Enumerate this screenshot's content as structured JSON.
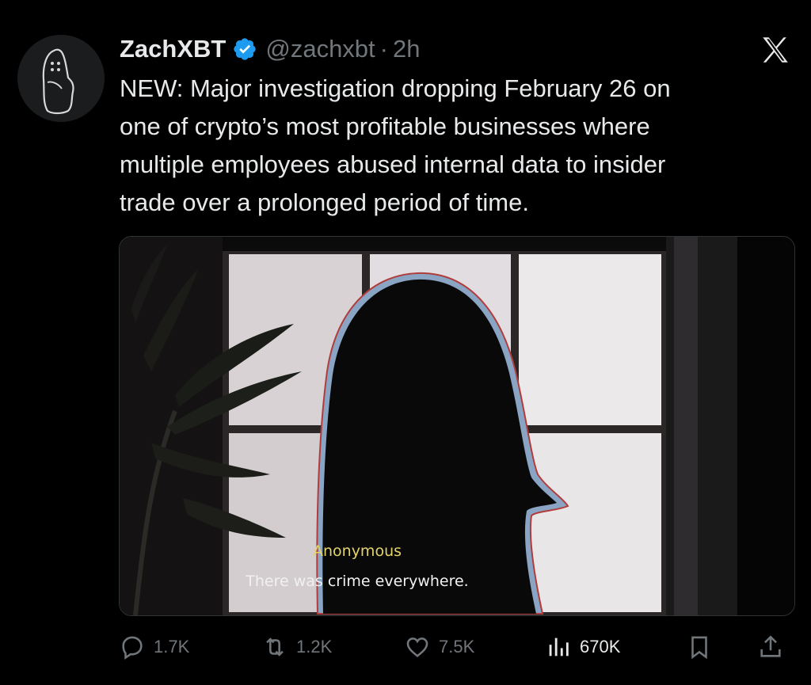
{
  "tweet": {
    "author_name": "ZachXBT",
    "handle": "@zachxbt",
    "separator": "·",
    "time": "2h",
    "text_lines": [
      "NEW: Major investigation dropping February 26 on",
      "one of crypto’s most profitable businesses where",
      "multiple employees abused internal data to insider",
      "trade over a prolonged period of time."
    ],
    "verified_color": "#1d9bf0"
  },
  "media": {
    "caption_speaker": "Anonymous",
    "caption_line": "There was crime everywhere."
  },
  "actions": {
    "replies": "1.7K",
    "reposts": "1.2K",
    "likes": "7.5K",
    "views": "670K"
  },
  "icons": [
    "avatar-ghost-icon",
    "verified-badge-icon",
    "x-logo-icon",
    "reply-icon",
    "repost-icon",
    "like-icon",
    "views-icon",
    "bookmark-icon",
    "share-icon"
  ]
}
